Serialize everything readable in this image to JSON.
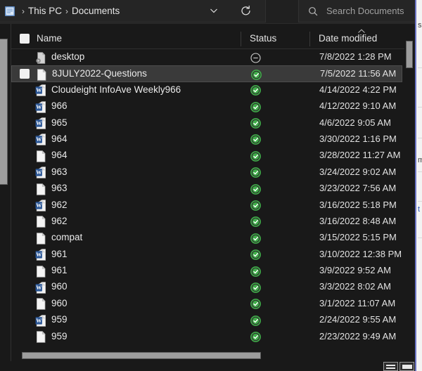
{
  "window": {
    "title": "Documents",
    "accent_selected_bg": "#3a3a3a",
    "status_ok_color": "#3fae49",
    "background_color": "#191919"
  },
  "toolbar": {
    "folder_icon": "documents-folder-icon",
    "breadcrumb": {
      "leading_separator": "›",
      "items": [
        {
          "label": "This PC",
          "separator": "›"
        },
        {
          "label": "Documents",
          "separator": ""
        }
      ]
    },
    "crumb_dropdown_icon": "chevron-down-icon",
    "refresh_icon": "refresh-icon",
    "search": {
      "icon": "search-icon",
      "placeholder": "Search Documents",
      "value": ""
    }
  },
  "columns": {
    "select_all_checkbox": "checkbox-unchecked",
    "headers": [
      {
        "label": "Name",
        "key": "name"
      },
      {
        "label": "Status",
        "key": "status"
      },
      {
        "label": "Date modified",
        "key": "date_modified"
      }
    ],
    "sort_indicator": {
      "column": "Date modified",
      "direction": "descending",
      "icon": "chevron-up-icon"
    }
  },
  "files": [
    {
      "name": "desktop",
      "icon": "ini-config-file-icon",
      "status": "unavailable-offline",
      "status_icon": "circle-minus-icon",
      "date_modified": "7/8/2022 1:28 PM",
      "selected": false,
      "checkbox": false
    },
    {
      "name": "8JULY2022-Questions",
      "icon": "generic-file-icon",
      "status": "available-on-device",
      "status_icon": "green-check-icon",
      "date_modified": "7/5/2022 11:56 AM",
      "selected": true,
      "checkbox": true
    },
    {
      "name": "Cloudeight InfoAve Weekly966",
      "icon": "word-document-icon",
      "status": "available-on-device",
      "status_icon": "green-check-icon",
      "date_modified": "4/14/2022 4:22 PM",
      "selected": false,
      "checkbox": false
    },
    {
      "name": "966",
      "icon": "word-document-icon",
      "status": "available-on-device",
      "status_icon": "green-check-icon",
      "date_modified": "4/12/2022 9:10 AM",
      "selected": false,
      "checkbox": false
    },
    {
      "name": "965",
      "icon": "word-document-icon",
      "status": "available-on-device",
      "status_icon": "green-check-icon",
      "date_modified": "4/6/2022 9:05 AM",
      "selected": false,
      "checkbox": false
    },
    {
      "name": "964",
      "icon": "word-document-icon",
      "status": "available-on-device",
      "status_icon": "green-check-icon",
      "date_modified": "3/30/2022 1:16 PM",
      "selected": false,
      "checkbox": false
    },
    {
      "name": "964",
      "icon": "generic-file-icon",
      "status": "available-on-device",
      "status_icon": "green-check-icon",
      "date_modified": "3/28/2022 11:27 AM",
      "selected": false,
      "checkbox": false
    },
    {
      "name": "963",
      "icon": "word-document-icon",
      "status": "available-on-device",
      "status_icon": "green-check-icon",
      "date_modified": "3/24/2022 9:02 AM",
      "selected": false,
      "checkbox": false
    },
    {
      "name": "963",
      "icon": "generic-file-icon",
      "status": "available-on-device",
      "status_icon": "green-check-icon",
      "date_modified": "3/23/2022 7:56 AM",
      "selected": false,
      "checkbox": false
    },
    {
      "name": "962",
      "icon": "word-document-icon",
      "status": "available-on-device",
      "status_icon": "green-check-icon",
      "date_modified": "3/16/2022 5:18 PM",
      "selected": false,
      "checkbox": false
    },
    {
      "name": "962",
      "icon": "generic-file-icon",
      "status": "available-on-device",
      "status_icon": "green-check-icon",
      "date_modified": "3/16/2022 8:48 AM",
      "selected": false,
      "checkbox": false
    },
    {
      "name": "compat",
      "icon": "generic-file-icon",
      "status": "available-on-device",
      "status_icon": "green-check-icon",
      "date_modified": "3/15/2022 5:15 PM",
      "selected": false,
      "checkbox": false
    },
    {
      "name": "961",
      "icon": "word-document-icon",
      "status": "available-on-device",
      "status_icon": "green-check-icon",
      "date_modified": "3/10/2022 12:38 PM",
      "selected": false,
      "checkbox": false
    },
    {
      "name": "961",
      "icon": "generic-file-icon",
      "status": "available-on-device",
      "status_icon": "green-check-icon",
      "date_modified": "3/9/2022 9:52 AM",
      "selected": false,
      "checkbox": false
    },
    {
      "name": "960",
      "icon": "word-document-icon",
      "status": "available-on-device",
      "status_icon": "green-check-icon",
      "date_modified": "3/3/2022 8:02 AM",
      "selected": false,
      "checkbox": false
    },
    {
      "name": "960",
      "icon": "generic-file-icon",
      "status": "available-on-device",
      "status_icon": "green-check-icon",
      "date_modified": "3/1/2022 11:07 AM",
      "selected": false,
      "checkbox": false
    },
    {
      "name": "959",
      "icon": "word-document-icon",
      "status": "available-on-device",
      "status_icon": "green-check-icon",
      "date_modified": "2/24/2022 9:55 AM",
      "selected": false,
      "checkbox": false
    },
    {
      "name": "959",
      "icon": "generic-file-icon",
      "status": "available-on-device",
      "status_icon": "green-check-icon",
      "date_modified": "2/23/2022 9:49 AM",
      "selected": false,
      "checkbox": false
    }
  ],
  "statusbar": {
    "view_buttons": [
      {
        "name": "list-view-button",
        "icon": "list-view-icon",
        "active": false
      },
      {
        "name": "details-view-button",
        "icon": "details-view-icon",
        "active": true
      }
    ]
  },
  "background_window": {
    "text_fragments": [
      "s",
      "m",
      "t"
    ]
  }
}
